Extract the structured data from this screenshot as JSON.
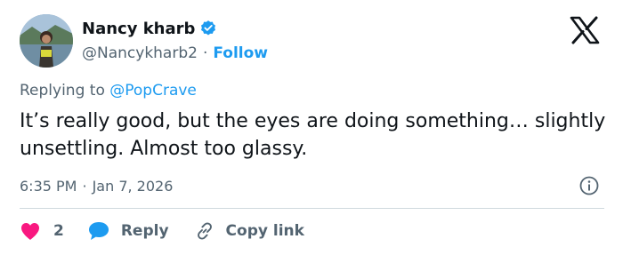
{
  "author": {
    "name": "Nancy kharb",
    "handle": "@Nancykharb2",
    "separator": "·",
    "follow_label": "Follow",
    "avatar_icon": "profile-photo",
    "verified_icon": "verified-badge-icon"
  },
  "platform": {
    "logo_icon": "x-logo-icon"
  },
  "reply_context": {
    "prefix": "Replying to",
    "mention": "@PopCrave"
  },
  "tweet": {
    "text": "It’s really good, but the eyes are doing something… slightly unsettling. Almost too glassy."
  },
  "meta": {
    "time": "6:35 PM",
    "separator": "·",
    "date": "Jan 7, 2026",
    "info_icon": "info-icon"
  },
  "actions": {
    "like_count": "2",
    "reply_label": "Reply",
    "copy_label": "Copy link",
    "like_icon": "heart-icon",
    "reply_icon": "speech-bubble-icon",
    "copy_icon": "link-icon"
  },
  "colors": {
    "accent": "#1d9bf0",
    "like": "#f91880",
    "text": "#0f1419",
    "secondary": "#536471",
    "divider": "#cfd9de"
  }
}
